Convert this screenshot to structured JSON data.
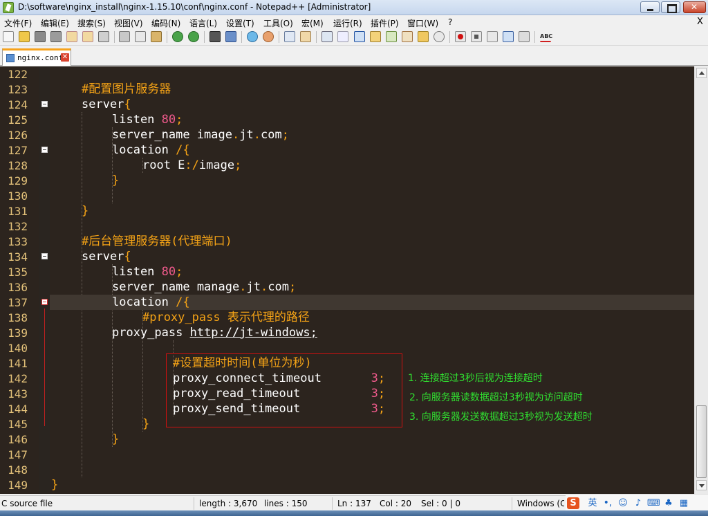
{
  "window": {
    "title": "D:\\software\\nginx_install\\nginx-1.15.10\\conf\\nginx.conf - Notepad++ [Administrator]"
  },
  "menu": {
    "items": [
      "文件(F)",
      "编辑(E)",
      "搜索(S)",
      "视图(V)",
      "编码(N)",
      "语言(L)",
      "设置(T)",
      "工具(O)",
      "宏(M)",
      "运行(R)",
      "插件(P)",
      "窗口(W)",
      "?"
    ],
    "close_glyph": "X"
  },
  "toolbar": {
    "icons": [
      "new-file-icon",
      "open-file-icon",
      "save-icon",
      "save-all-icon",
      "close-icon",
      "close-all-icon",
      "print-icon",
      "cut-icon",
      "copy-icon",
      "paste-icon",
      "undo-icon",
      "redo-icon",
      "find-icon",
      "replace-icon",
      "zoom-in-icon",
      "zoom-out-icon",
      "sync-v-icon",
      "sync-h-icon",
      "word-wrap-icon",
      "show-all-chars-icon",
      "indent-guide-icon",
      "udl-icon",
      "doc-map-icon",
      "function-list-icon",
      "folder-workspace-icon",
      "monitor-icon",
      "record-macro-icon",
      "stop-macro-icon",
      "play-macro-icon",
      "run-macro-multi-icon",
      "save-macro-icon",
      "spellcheck-icon"
    ]
  },
  "tab": {
    "label": "nginx.conf",
    "close_glyph": "✕"
  },
  "editor": {
    "lines": [
      {
        "n": "122",
        "indent": 0,
        "tokens": []
      },
      {
        "n": "123",
        "indent": 1,
        "tokens": [
          {
            "t": "#配置图片服务器",
            "c": "cmt"
          }
        ]
      },
      {
        "n": "124",
        "indent": 1,
        "fold": true,
        "tokens": [
          {
            "t": "server",
            "c": "kw"
          },
          {
            "t": "{",
            "c": "br"
          }
        ]
      },
      {
        "n": "125",
        "indent": 2,
        "tokens": [
          {
            "t": "listen ",
            "c": "kw"
          },
          {
            "t": "80",
            "c": "num"
          },
          {
            "t": ";",
            "c": "op"
          }
        ]
      },
      {
        "n": "126",
        "indent": 2,
        "tokens": [
          {
            "t": "server_name image",
            "c": "kw"
          },
          {
            "t": ".",
            "c": "op"
          },
          {
            "t": "jt",
            "c": "kw"
          },
          {
            "t": ".",
            "c": "op"
          },
          {
            "t": "com",
            "c": "kw"
          },
          {
            "t": ";",
            "c": "op"
          }
        ]
      },
      {
        "n": "127",
        "indent": 2,
        "fold": true,
        "tokens": [
          {
            "t": "location ",
            "c": "kw"
          },
          {
            "t": "/{",
            "c": "br"
          }
        ]
      },
      {
        "n": "128",
        "indent": 3,
        "tokens": [
          {
            "t": "root E",
            "c": "kw"
          },
          {
            "t": ":/",
            "c": "op"
          },
          {
            "t": "image",
            "c": "kw"
          },
          {
            "t": ";",
            "c": "op"
          }
        ]
      },
      {
        "n": "129",
        "indent": 2,
        "tokens": [
          {
            "t": "}",
            "c": "br"
          }
        ]
      },
      {
        "n": "130",
        "indent": 0,
        "tokens": []
      },
      {
        "n": "131",
        "indent": 1,
        "tokens": [
          {
            "t": "}",
            "c": "br"
          }
        ]
      },
      {
        "n": "132",
        "indent": 0,
        "tokens": []
      },
      {
        "n": "133",
        "indent": 1,
        "tokens": [
          {
            "t": "#后台管理服务器(代理端口)",
            "c": "cmt"
          }
        ]
      },
      {
        "n": "134",
        "indent": 1,
        "fold": true,
        "tokens": [
          {
            "t": "server",
            "c": "kw"
          },
          {
            "t": "{",
            "c": "br"
          }
        ]
      },
      {
        "n": "135",
        "indent": 2,
        "tokens": [
          {
            "t": "listen ",
            "c": "kw"
          },
          {
            "t": "80",
            "c": "num"
          },
          {
            "t": ";",
            "c": "op"
          }
        ]
      },
      {
        "n": "136",
        "indent": 2,
        "tokens": [
          {
            "t": "server_name manage",
            "c": "kw"
          },
          {
            "t": ".",
            "c": "op"
          },
          {
            "t": "jt",
            "c": "kw"
          },
          {
            "t": ".",
            "c": "op"
          },
          {
            "t": "com",
            "c": "kw"
          },
          {
            "t": ";",
            "c": "op"
          }
        ]
      },
      {
        "n": "137",
        "indent": 2,
        "fold": true,
        "foldRed": true,
        "current": true,
        "tokens": [
          {
            "t": "location ",
            "c": "kw"
          },
          {
            "t": "/{",
            "c": "br"
          }
        ]
      },
      {
        "n": "138",
        "indent": 3,
        "tokens": [
          {
            "t": "#proxy_pass",
            "c": "cmt"
          },
          {
            "t": " 表示代理的路径",
            "c": "cmt"
          }
        ]
      },
      {
        "n": "139",
        "indent": 2,
        "tokens": [
          {
            "t": "proxy_pass ",
            "c": "kw"
          },
          {
            "t": "http://jt-windows;",
            "c": "link"
          }
        ]
      },
      {
        "n": "140",
        "indent": 0,
        "tokens": []
      },
      {
        "n": "141",
        "indent": 4,
        "tokens": [
          {
            "t": "#设置超时时间(单位为秒)",
            "c": "cmt"
          }
        ]
      },
      {
        "n": "142",
        "indent": 4,
        "tokens": [
          {
            "t": "proxy_connect_timeout       ",
            "c": "kw"
          },
          {
            "t": "3",
            "c": "num"
          },
          {
            "t": ";",
            "c": "op"
          }
        ]
      },
      {
        "n": "143",
        "indent": 4,
        "tokens": [
          {
            "t": "proxy_read_timeout          ",
            "c": "kw"
          },
          {
            "t": "3",
            "c": "num"
          },
          {
            "t": ";",
            "c": "op"
          }
        ]
      },
      {
        "n": "144",
        "indent": 4,
        "tokens": [
          {
            "t": "proxy_send_timeout          ",
            "c": "kw"
          },
          {
            "t": "3",
            "c": "num"
          },
          {
            "t": ";",
            "c": "op"
          }
        ]
      },
      {
        "n": "145",
        "indent": 3,
        "tokens": [
          {
            "t": "}",
            "c": "br"
          }
        ]
      },
      {
        "n": "146",
        "indent": 2,
        "tokens": [
          {
            "t": "}",
            "c": "br"
          }
        ]
      },
      {
        "n": "147",
        "indent": 0,
        "tokens": []
      },
      {
        "n": "148",
        "indent": 0,
        "tokens": []
      },
      {
        "n": "149",
        "indent": 0,
        "tokens": [
          {
            "t": "}",
            "c": "br"
          }
        ]
      }
    ]
  },
  "annotations": [
    "1. 连接超过3秒后视为连接超时",
    "2. 向服务器读数据超过3秒视为访问超时",
    "3. 向服务器发送数据超过3秒视为发送超时"
  ],
  "statusbar": {
    "filetype": "C source file",
    "length": "length : 3,670",
    "lines": "lines : 150",
    "ln": "Ln : 137",
    "col": "Col : 20",
    "sel": "Sel : 0 | 0",
    "eol": "Windows (CR LF)"
  },
  "ime": {
    "sogou": "S",
    "lang": "英"
  },
  "colors": {
    "editor_bg": "#2c241e",
    "line_number": "#e4c27a",
    "comment": "#f5a316",
    "number": "#f05a8c",
    "annotation": "#30e030",
    "annotation_box": "#d01010"
  }
}
